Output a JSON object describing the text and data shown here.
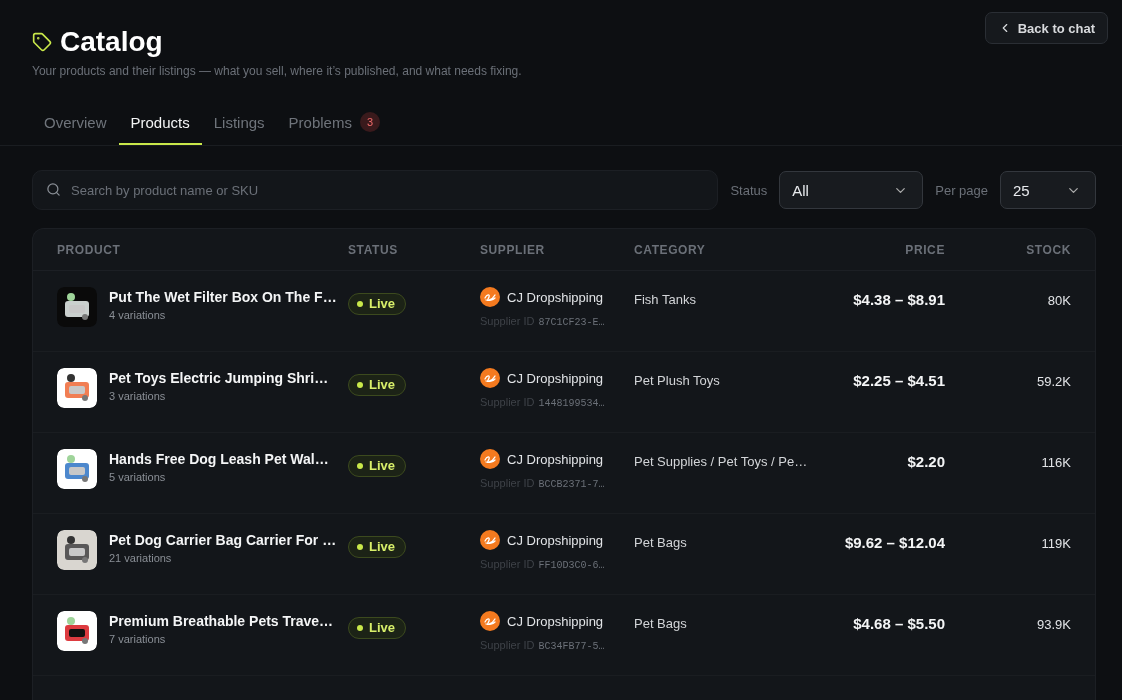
{
  "header": {
    "title": "Catalog",
    "subtitle": "Your products and their listings — what you sell, where it’s published, and what needs fixing.",
    "back_button": "Back to chat"
  },
  "tabs": [
    {
      "label": "Overview",
      "selected": false
    },
    {
      "label": "Products",
      "selected": true
    },
    {
      "label": "Listings",
      "selected": false
    },
    {
      "label": "Problems",
      "selected": false,
      "badge": "3"
    }
  ],
  "filters": {
    "search": {
      "placeholder": "Search by product name or SKU"
    },
    "status": {
      "label": "Status",
      "value": "All"
    },
    "per_page": {
      "label": "Per page",
      "value": "25"
    }
  },
  "table": {
    "columns": [
      "PRODUCT",
      "STATUS",
      "SUPPLIER",
      "CATEGORY",
      "PRICE",
      "STOCK"
    ],
    "rows": [
      {
        "name": "Put The Wet Filter Box On The F…",
        "variations": "4 variations",
        "status": {
          "label": "Live",
          "kind": "live"
        },
        "supplier": "CJ Dropshipping",
        "supplier_id_label": "Supplier ID",
        "supplier_id": "87C1CF23-E…",
        "category": "Fish Tanks",
        "price": "$4.38 – $8.91",
        "stock": "80K"
      },
      {
        "name": "Pet Toys Electric Jumping Shri…",
        "variations": "3 variations",
        "status": {
          "label": "Live",
          "kind": "live"
        },
        "supplier": "CJ Dropshipping",
        "supplier_id_label": "Supplier ID",
        "supplier_id": "1448199534…",
        "category": "Pet Plush Toys",
        "price": "$2.25 – $4.51",
        "stock": "59.2K"
      },
      {
        "name": "Hands Free Dog Leash Pet Wal…",
        "variations": "5 variations",
        "status": {
          "label": "Live",
          "kind": "live"
        },
        "supplier": "CJ Dropshipping",
        "supplier_id_label": "Supplier ID",
        "supplier_id": "BCCB2371-7…",
        "category": "Pet Supplies / Pet Toys / Pe…",
        "price": "$2.20",
        "stock": "116K"
      },
      {
        "name": "Pet Dog Carrier Bag Carrier For …",
        "variations": "21 variations",
        "status": {
          "label": "Live",
          "kind": "live"
        },
        "supplier": "CJ Dropshipping",
        "supplier_id_label": "Supplier ID",
        "supplier_id": "FF10D3C0-6…",
        "category": "Pet Bags",
        "price": "$9.62 – $12.04",
        "stock": "119K"
      },
      {
        "name": "Premium Breathable Pets Trave…",
        "variations": "7 variations",
        "status": {
          "label": "Live",
          "kind": "live"
        },
        "supplier": "CJ Dropshipping",
        "supplier_id_label": "Supplier ID",
        "supplier_id": "BC34FB77-5…",
        "category": "Pet Bags",
        "price": "$4.68 – $5.50",
        "stock": "93.9K"
      }
    ]
  }
}
